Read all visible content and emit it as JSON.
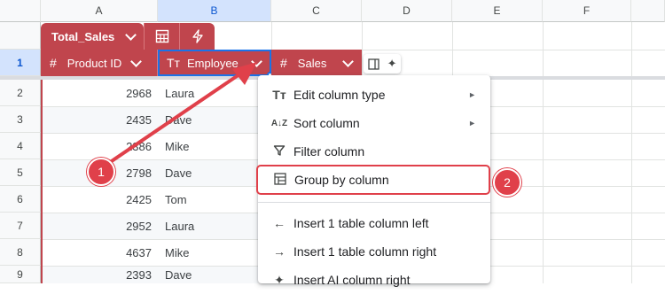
{
  "columns": [
    "A",
    "B",
    "C",
    "D",
    "E",
    "F"
  ],
  "rows": [
    "1",
    "2",
    "3",
    "4",
    "5",
    "6",
    "7",
    "8",
    "9"
  ],
  "table": {
    "name": "Total_Sales",
    "headers": [
      "Product ID",
      "Employee",
      "Sales"
    ],
    "header_type_icons": [
      "#",
      "Tт",
      "#"
    ],
    "data": [
      {
        "product_id": "2968",
        "employee": "Laura"
      },
      {
        "product_id": "2435",
        "employee": "Dave"
      },
      {
        "product_id": "2386",
        "employee": "Mike"
      },
      {
        "product_id": "2798",
        "employee": "Dave"
      },
      {
        "product_id": "2425",
        "employee": "Tom"
      },
      {
        "product_id": "2952",
        "employee": "Laura"
      },
      {
        "product_id": "4637",
        "employee": "Mike"
      },
      {
        "product_id": "2393",
        "employee": "Dave"
      }
    ]
  },
  "menu": {
    "items": [
      {
        "label": "Edit column type",
        "icon": "Tт",
        "submenu": true
      },
      {
        "label": "Sort column",
        "icon": "A↓Z",
        "submenu": true
      },
      {
        "label": "Filter column",
        "icon": "filter-icon",
        "submenu": false
      },
      {
        "label": "Group by column",
        "icon": "group-icon",
        "submenu": false
      },
      {
        "label": "Insert 1 table column left",
        "icon": "←",
        "submenu": false
      },
      {
        "label": "Insert 1 table column right",
        "icon": "→",
        "submenu": false
      },
      {
        "label": "Insert AI column right",
        "icon": "✦",
        "submenu": false
      }
    ],
    "submenu_glyph": "►"
  },
  "annotations": {
    "step1": "1",
    "step2": "2"
  },
  "colors": {
    "table_header": "#c0454d",
    "annotation": "#e0404a",
    "selection": "#1a73e8"
  }
}
